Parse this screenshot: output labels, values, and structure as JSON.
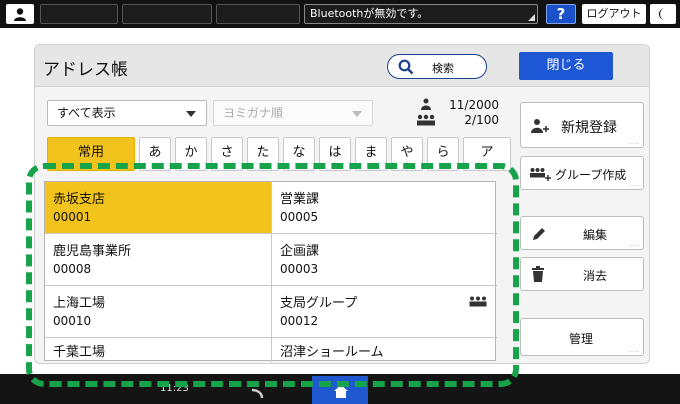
{
  "statusbar": {
    "message": "Bluetoothが無効です。",
    "help_label": "?",
    "logout_label": "ログアウト"
  },
  "dialog": {
    "title": "アドレス帳",
    "search_label": "検索",
    "close_label": "閉じる",
    "filter_display": "すべて表示",
    "sort_order": "ヨミガナ順",
    "count_individuals": "11/2000",
    "count_groups": "2/100",
    "tabs": [
      "常用",
      "あ",
      "か",
      "さ",
      "た",
      "な",
      "は",
      "ま",
      "や",
      "ら",
      "ア"
    ]
  },
  "side_buttons": {
    "register": "新規登録",
    "create_group": "グループ作成",
    "edit": "編集",
    "delete": "消去",
    "manage": "管理"
  },
  "entries": [
    {
      "name": "赤坂支店",
      "id": "00001",
      "selected": true,
      "group": false
    },
    {
      "name": "営業課",
      "id": "00005",
      "selected": false,
      "group": false
    },
    {
      "name": "鹿児島事業所",
      "id": "00008",
      "selected": false,
      "group": false
    },
    {
      "name": "企画課",
      "id": "00003",
      "selected": false,
      "group": false
    },
    {
      "name": "上海工場",
      "id": "00010",
      "selected": false,
      "group": false
    },
    {
      "name": "支局グループ",
      "id": "00012",
      "selected": false,
      "group": true
    },
    {
      "name": "千葉工場",
      "id": "",
      "selected": false,
      "group": false
    },
    {
      "name": "沼津ショールーム",
      "id": "",
      "selected": false,
      "group": false
    }
  ],
  "bottombar": {
    "clock": "11:23"
  },
  "colors": {
    "selected": "#f2c31c",
    "primary": "#1e57d6",
    "highlight_outline": "#16a34a"
  }
}
